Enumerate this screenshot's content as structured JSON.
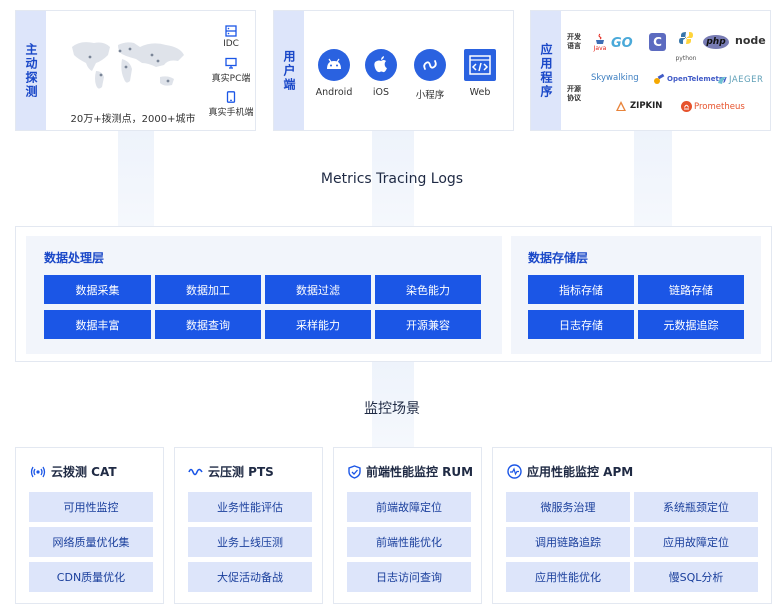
{
  "top": {
    "probe": {
      "label": "主动探测",
      "stats": "20万+拨测点，2000+城市",
      "items": [
        "IDC",
        "真实PC端",
        "真实手机端"
      ]
    },
    "user_client": {
      "label": "用户端",
      "clients": [
        "Android",
        "iOS",
        "小程序",
        "Web"
      ]
    },
    "application": {
      "label": "应用程序",
      "dev_lang_label": "开发语言",
      "open_source_label": "开源协议",
      "languages": [
        "Java",
        "GO",
        "C",
        "python",
        "php",
        "node"
      ],
      "protocols": [
        "Skywalking",
        "OpenTelemetry",
        "JAEGER",
        "ZIPKIN",
        "Prometheus"
      ]
    }
  },
  "captions": {
    "metrics": "Metrics Tracing Logs",
    "scenes": "监控场景"
  },
  "processing": {
    "title": "数据处理层",
    "items": [
      "数据采集",
      "数据加工",
      "数据过滤",
      "染色能力",
      "数据丰富",
      "数据查询",
      "采样能力",
      "开源兼容"
    ]
  },
  "storage": {
    "title": "数据存储层",
    "items": [
      "指标存储",
      "链路存储",
      "日志存储",
      "元数据追踪"
    ]
  },
  "scenes": {
    "cat": {
      "title": "云拨测 CAT",
      "items": [
        "可用性监控",
        "网络质量优化集",
        "CDN质量优化"
      ]
    },
    "pts": {
      "title": "云压测 PTS",
      "items": [
        "业务性能评估",
        "业务上线压测",
        "大促活动备战"
      ]
    },
    "rum": {
      "title": "前端性能监控 RUM",
      "items": [
        "前端故障定位",
        "前端性能优化",
        "日志访问查询"
      ]
    },
    "apm": {
      "title": "应用性能监控 APM",
      "items": [
        "微服务治理",
        "系统瓶颈定位",
        "调用链路追踪",
        "应用故障定位",
        "应用性能优化",
        "慢SQL分析"
      ]
    }
  },
  "colors": {
    "primary_blue": "#1b56e6",
    "label_bg": "#dde5fa",
    "layer_bg": "#f2f5fb"
  }
}
